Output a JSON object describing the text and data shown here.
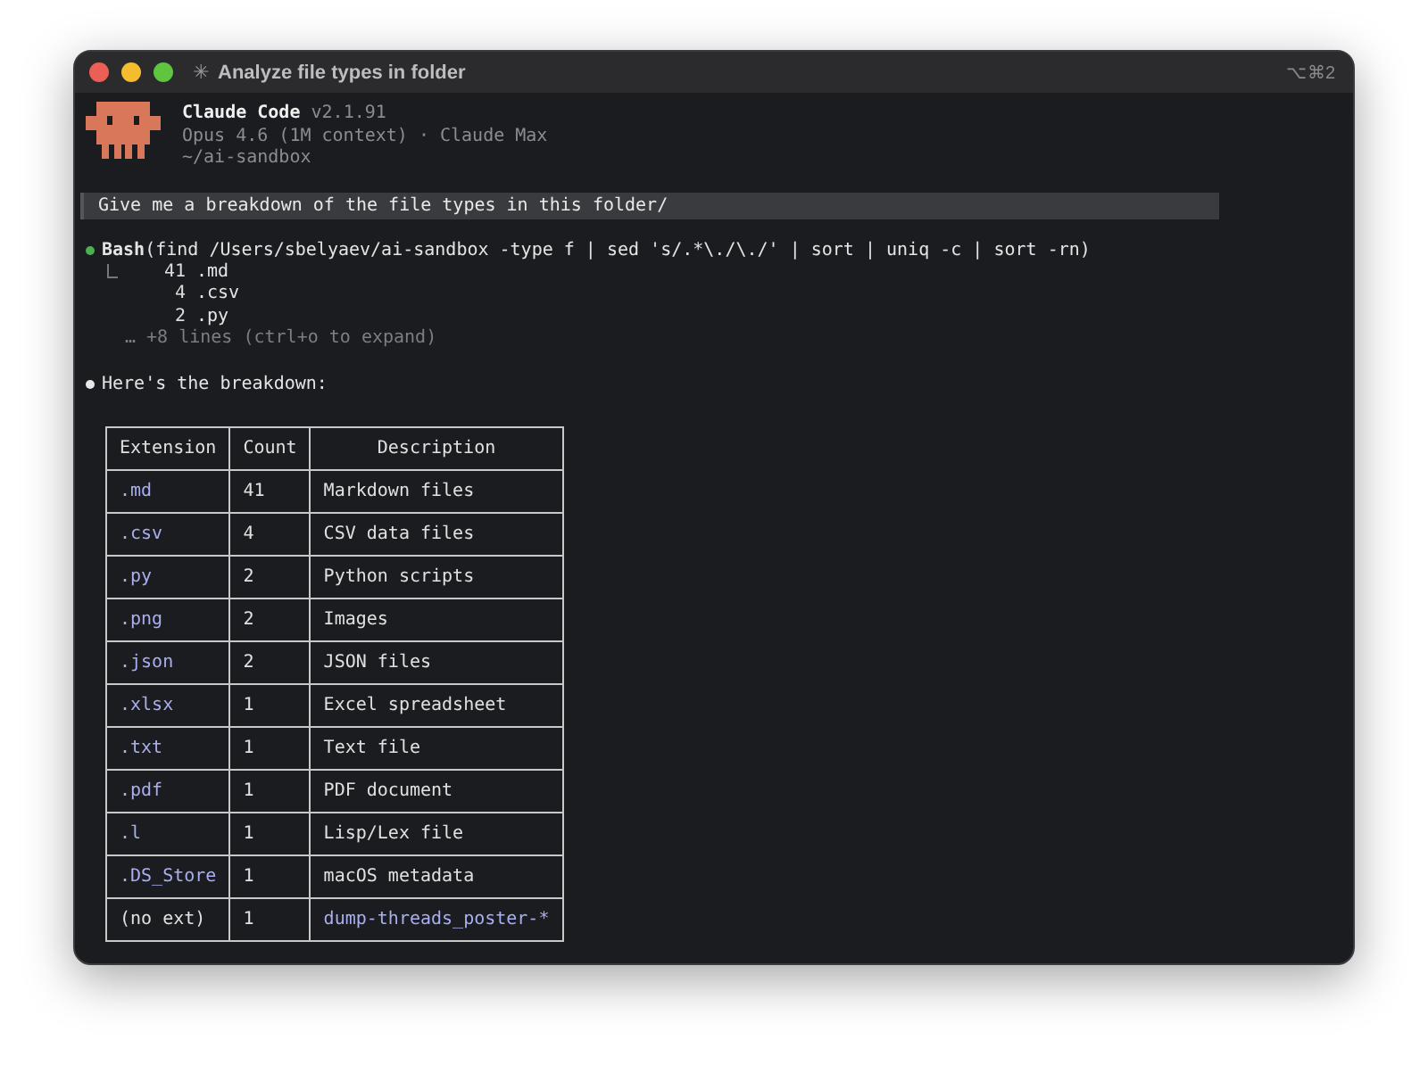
{
  "window": {
    "title_icon": "✳",
    "title": "Analyze file types in folder",
    "shortcut": "⌥⌘2"
  },
  "header": {
    "app_name": "Claude Code",
    "version": "v2.1.91",
    "model": "Opus 4.6 (1M context) · Claude Max",
    "path": "~/ai-sandbox"
  },
  "prompt": "Give me a breakdown of the file types in this folder/",
  "tool_call": {
    "color": "#4caf50",
    "command": "**Bash**(find /Users/sbelyaev/ai-sandbox -type f | sed 's/.*\\./\\./' | sort | uniq -c | sort -rn)",
    "output": [
      {
        "count": "41",
        "name": ".md"
      },
      {
        "count": "4",
        "name": ".csv"
      },
      {
        "count": "2",
        "name": ".py"
      }
    ],
    "more": "… +8 lines (ctrl+o to expand)"
  },
  "reply": {
    "color": "#e8e8e8",
    "text": "Here's the breakdown:"
  },
  "table": {
    "columns": [
      "Extension",
      "Count",
      "Description"
    ],
    "rows": [
      [
        {
          "text": ".md",
          "code": true
        },
        {
          "text": "41",
          "code": false
        },
        {
          "text": "Markdown files",
          "code": false
        }
      ],
      [
        {
          "text": ".csv",
          "code": true
        },
        {
          "text": "4",
          "code": false
        },
        {
          "text": "CSV data files",
          "code": false
        }
      ],
      [
        {
          "text": ".py",
          "code": true
        },
        {
          "text": "2",
          "code": false
        },
        {
          "text": "Python scripts",
          "code": false
        }
      ],
      [
        {
          "text": ".png",
          "code": true
        },
        {
          "text": "2",
          "code": false
        },
        {
          "text": "Images",
          "code": false
        }
      ],
      [
        {
          "text": ".json",
          "code": true
        },
        {
          "text": "2",
          "code": false
        },
        {
          "text": "JSON files",
          "code": false
        }
      ],
      [
        {
          "text": ".xlsx",
          "code": true
        },
        {
          "text": "1",
          "code": false
        },
        {
          "text": "Excel spreadsheet",
          "code": false
        }
      ],
      [
        {
          "text": ".txt",
          "code": true
        },
        {
          "text": "1",
          "code": false
        },
        {
          "text": "Text file",
          "code": false
        }
      ],
      [
        {
          "text": ".pdf",
          "code": true
        },
        {
          "text": "1",
          "code": false
        },
        {
          "text": "PDF document",
          "code": false
        }
      ],
      [
        {
          "text": ".l",
          "code": true
        },
        {
          "text": "1",
          "code": false
        },
        {
          "text": "Lisp/Lex file",
          "code": false
        }
      ],
      [
        {
          "text": ".DS_Store",
          "code": true
        },
        {
          "text": "1",
          "code": false
        },
        {
          "text": "macOS metadata",
          "code": false
        }
      ],
      [
        {
          "text": "(no ext)",
          "code": false
        },
        {
          "text": "1",
          "code": false
        },
        {
          "text": "dump-threads_poster-*",
          "code": true
        }
      ]
    ]
  }
}
